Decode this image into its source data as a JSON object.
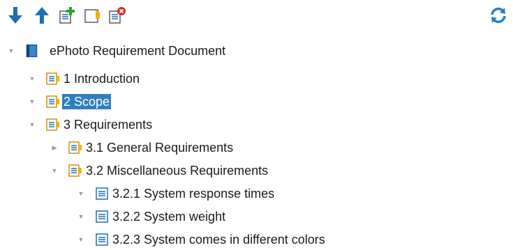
{
  "toolbar": {
    "buttons": [
      {
        "icon": "arrow-down-icon",
        "name": "move-down-button"
      },
      {
        "icon": "arrow-up-icon",
        "name": "move-up-button"
      },
      {
        "icon": "add-child-icon",
        "name": "add-child-button"
      },
      {
        "icon": "add-sibling-icon",
        "name": "add-sibling-button"
      },
      {
        "icon": "delete-icon",
        "name": "delete-button"
      }
    ],
    "refresh_icon": "refresh-icon"
  },
  "colors": {
    "accent": "#1f6fb5",
    "selection": "#2f7fbf",
    "folder": "#f2b200",
    "refresh": "#2a7fc0"
  },
  "tree": {
    "root": {
      "label": "ePhoto Requirement Document",
      "expanded": true
    },
    "nodes": [
      {
        "label": "1 Introduction",
        "level": 1,
        "icon": "section-icon",
        "expanded": true,
        "selected": false
      },
      {
        "label": "2 Scope",
        "level": 1,
        "icon": "section-icon",
        "expanded": true,
        "selected": true
      },
      {
        "label": "3 Requirements",
        "level": 1,
        "icon": "section-icon",
        "expanded": true,
        "selected": false
      },
      {
        "label": "3.1 General Requirements",
        "level": 2,
        "icon": "section-icon",
        "expanded": false,
        "selected": false
      },
      {
        "label": "3.2 Miscellaneous Requirements",
        "level": 2,
        "icon": "section-icon",
        "expanded": true,
        "selected": false
      },
      {
        "label": "3.2.1 System response times",
        "level": 3,
        "icon": "requirement-icon",
        "expanded": true,
        "selected": false
      },
      {
        "label": "3.2.2 System weight",
        "level": 3,
        "icon": "requirement-icon",
        "expanded": true,
        "selected": false
      },
      {
        "label": "3.2.3 System comes in different colors",
        "level": 3,
        "icon": "requirement-icon",
        "expanded": true,
        "selected": false
      }
    ]
  }
}
